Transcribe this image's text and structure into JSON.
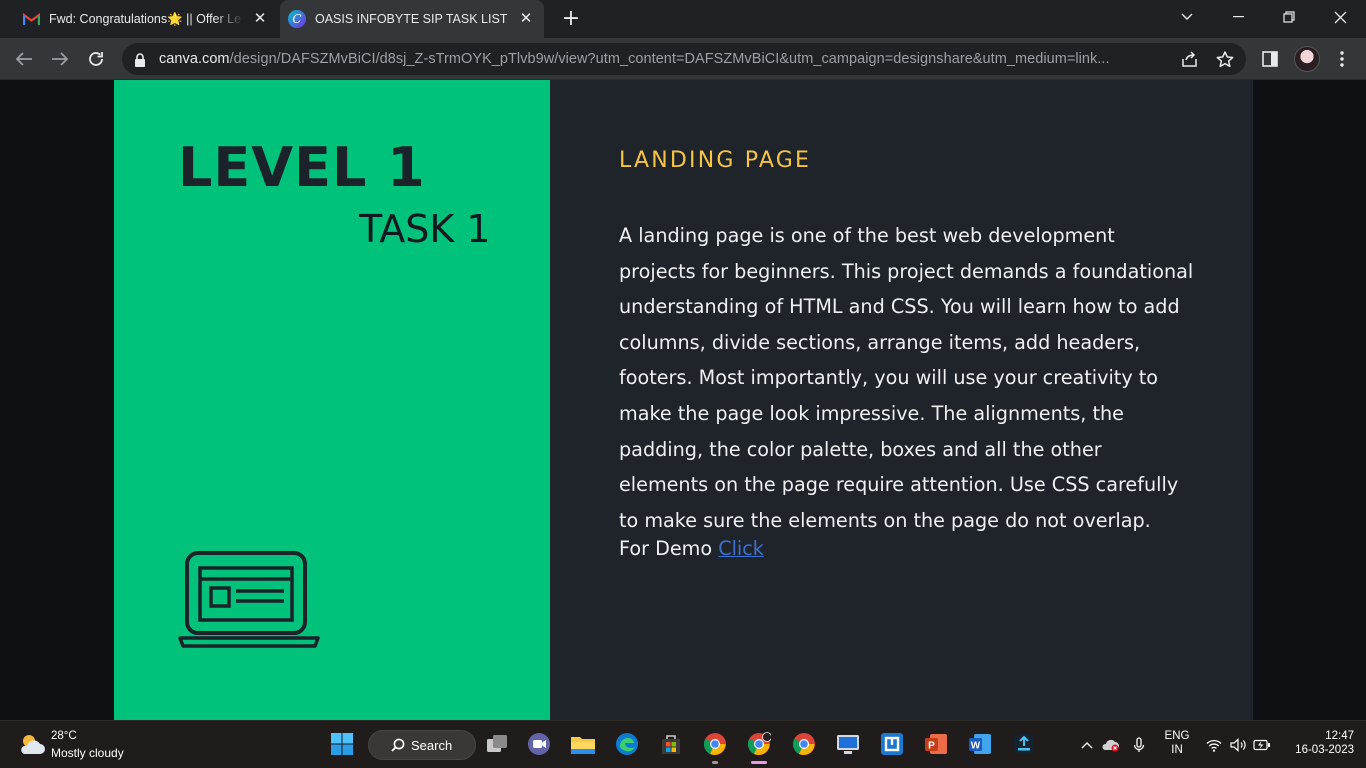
{
  "browser": {
    "tabs": [
      {
        "title": "Fwd: Congratulations🌟 || Offer Le",
        "icon": "gmail-icon",
        "active": false
      },
      {
        "title": "OASIS INFOBYTE SIP TASK LIST",
        "icon": "canva-icon",
        "active": true
      }
    ],
    "address_bar": {
      "host": "canva.com",
      "path": "/design/DAFSZMvBiCI/d8sj_Z-sTrmOYK_pTlvb9w/view?utm_content=DAFSZMvBiCI&utm_campaign=designshare&utm_medium=link..."
    }
  },
  "slide": {
    "left_panel": {
      "title": "LEVEL 1",
      "subtitle": "TASK 1",
      "background": "#00c27a",
      "icon": "laptop-icon"
    },
    "right_panel": {
      "heading": "LANDING PAGE",
      "heading_color": "#f6c343",
      "paragraph": "A landing page is one of the best web development projects for beginners. This project demands a foundational understanding of HTML and CSS. You will learn how to add columns, divide sections, arrange items, add headers, footers. Most importantly, you will use your creativity to make the page look impressive. The alignments, the padding, the color palette, boxes and all the other elements on the page require attention. Use CSS carefully to make sure the elements on the page do not overlap.",
      "demo_prefix": "For Demo",
      "demo_link": "Click ",
      "background": "#1f242b"
    }
  },
  "taskbar": {
    "weather": {
      "temp": "28°C",
      "desc": "Mostly cloudy"
    },
    "search_label": "Search",
    "language": {
      "line1": "ENG",
      "line2": "IN"
    },
    "clock": {
      "time": "12:47",
      "date": "16-03-2023"
    }
  }
}
